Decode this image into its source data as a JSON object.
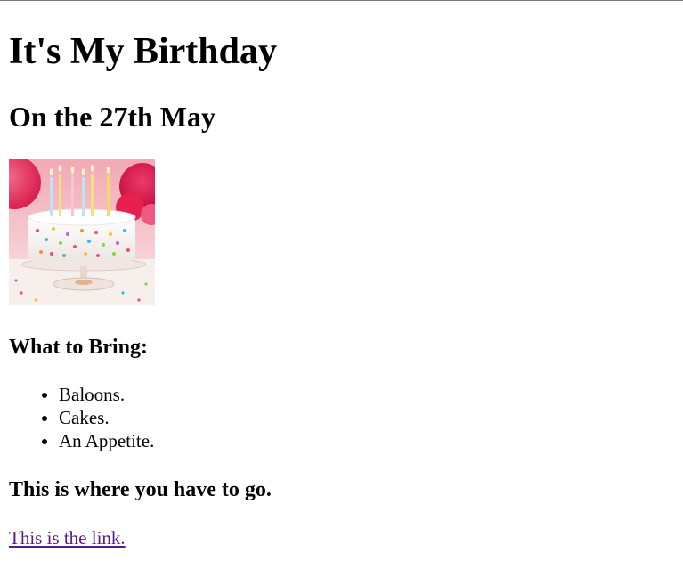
{
  "page": {
    "title": "It's My Birthday",
    "subtitle": "On the 27th May",
    "image": {
      "icon": "birthday-cake-photo",
      "alt": "birthday cake with candles"
    },
    "bring_heading": "What to Bring:",
    "bring_items": [
      {
        "label": "Baloons."
      },
      {
        "label": "Cakes."
      },
      {
        "label": "An Appetite."
      }
    ],
    "where_heading": "This is where you have to go.",
    "link_text": "This is the link.",
    "link_color": "#551a8b"
  }
}
